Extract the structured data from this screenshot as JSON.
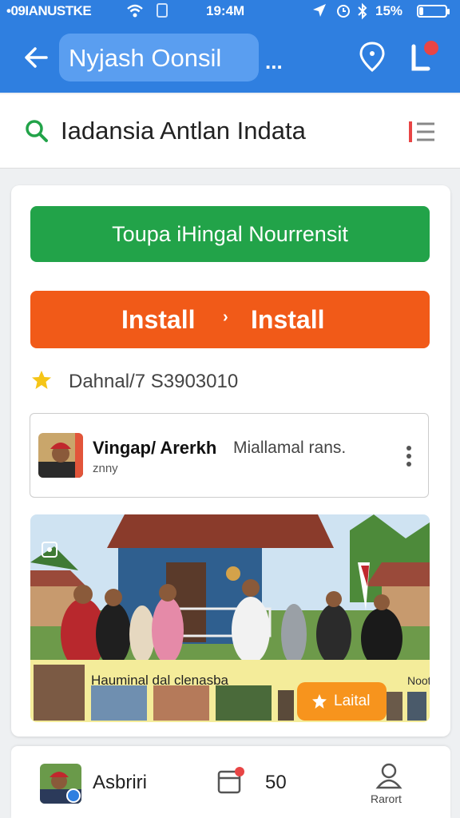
{
  "status_bar": {
    "carrier": "•09IANUSTKE",
    "time": "19:4M",
    "battery_text": "15%",
    "battery_level": 0.15,
    "icons": [
      "wifi-icon",
      "sim-icon",
      "location-arrow-icon",
      "alarm-icon",
      "bluetooth-icon",
      "battery-icon"
    ]
  },
  "header": {
    "title": "Nyjash Oonsil",
    "ellipsis": "...",
    "icons": [
      "back-arrow-icon",
      "pin-icon",
      "notification-icon"
    ],
    "colors": {
      "bar": "#2f7fe0",
      "title_box": "#5a9ef0",
      "badge": "#e84545"
    }
  },
  "search": {
    "query": "Iadansia Antlan Indata",
    "icons": [
      "search-icon",
      "filter-icon"
    ],
    "icon_color": "#22a349",
    "filter_color": "#e84545"
  },
  "actions": {
    "primary_label": "Toupa iHingal Nourrensit",
    "primary_color": "#22a349",
    "install_label_1": "Install",
    "install_arrow": "›",
    "install_label_2": "Install",
    "install_color": "#f15a18"
  },
  "rating": {
    "text": "Dahnal/7 S3903010",
    "icon": "star-icon",
    "star_color": "#f5c518"
  },
  "post": {
    "author": "Vingap/ Arerkh",
    "description": "Miallamal rans.",
    "subtitle": "znny",
    "icons": [
      "avatar",
      "more-vert-icon"
    ]
  },
  "photo": {
    "caption": "Hauminal dal clenasba",
    "note": "Noot",
    "button_label": "Laital",
    "icons": [
      "gallery-icon",
      "star-badge-icon"
    ],
    "strip_color": "#f4ec9a",
    "button_color": "#f7941d"
  },
  "bottom_nav": {
    "profile_name": "Asbriri",
    "calendar_count": "50",
    "user_label": "Rarort",
    "icons": [
      "profile-avatar",
      "calendar-icon",
      "user-icon"
    ]
  }
}
